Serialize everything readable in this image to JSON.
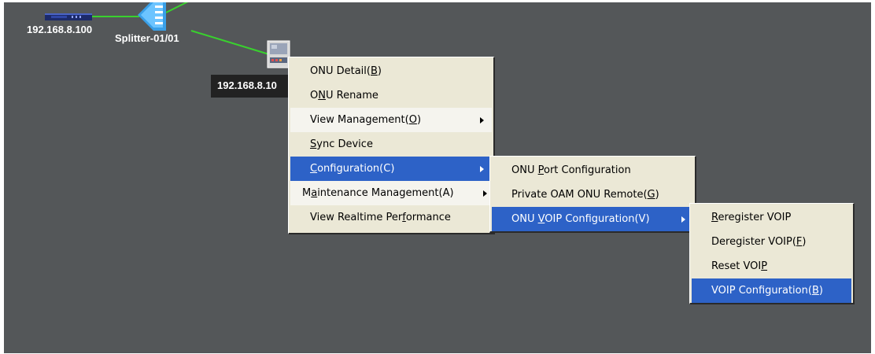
{
  "topology": {
    "nodes": {
      "olt": {
        "ip": "192.168.8.100",
        "icon": "olt-device-icon"
      },
      "splitter": {
        "name": "Splitter-01/01",
        "icon": "splitter-icon"
      },
      "onu": {
        "ip": "192.168.8.10",
        "icon": "onu-device-icon"
      }
    },
    "link_color": "#39d12e",
    "background_color": "#545759"
  },
  "context_menu": {
    "items": [
      {
        "pre": "ONU Detail(",
        "key": "B",
        "post": ")"
      },
      {
        "pre": "O",
        "key": "N",
        "post": "U Rename"
      },
      {
        "pre": "View Management(",
        "key": "O",
        "post": ")",
        "submenu": true
      },
      {
        "pre": "",
        "key": "S",
        "post": "ync Device"
      },
      {
        "pre": "",
        "key": "C",
        "post": "onfiguration(C)",
        "submenu": true
      },
      {
        "pre": "M",
        "key": "a",
        "post": "intenance Management(A)",
        "submenu": true
      },
      {
        "pre": "View Realtime Per",
        "key": "f",
        "post": "ormance"
      }
    ]
  },
  "config_submenu": {
    "items": [
      {
        "pre": "ONU ",
        "key": "P",
        "post": "ort Configuration"
      },
      {
        "pre": "Private OAM ONU Remote(",
        "key": "G",
        "post": ")"
      },
      {
        "pre": "ONU ",
        "key": "V",
        "post": "OIP Configuration(V)",
        "submenu": true
      }
    ]
  },
  "voip_submenu": {
    "items": [
      {
        "pre": "",
        "key": "R",
        "post": "eregister VOIP"
      },
      {
        "pre": "Deregister VOIP(",
        "key": "F",
        "post": ")"
      },
      {
        "pre": "Reset VOI",
        "key": "P",
        "post": ""
      },
      {
        "pre": "VOIP Configuration(",
        "key": "B",
        "post": ")"
      }
    ]
  },
  "colors": {
    "menu_bg": "#ebe8d6",
    "selection": "#2d62c7"
  }
}
